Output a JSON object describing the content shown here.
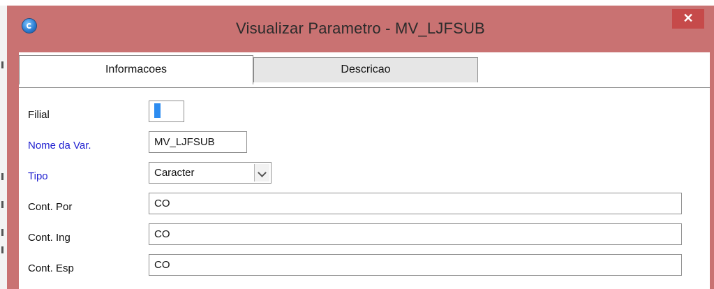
{
  "window": {
    "title": "Visualizar Parametro - MV_LJFSUB",
    "close_label": "✕"
  },
  "tabs": [
    {
      "label": "Informacoes",
      "active": true
    },
    {
      "label": "Descricao",
      "active": false
    }
  ],
  "form": {
    "filial": {
      "label": "Filial",
      "value": ""
    },
    "nome_var": {
      "label": "Nome da Var.",
      "value": "MV_LJFSUB"
    },
    "tipo": {
      "label": "Tipo",
      "value": "Caracter"
    },
    "cont_por": {
      "label": "Cont. Por",
      "value": "CO"
    },
    "cont_ing": {
      "label": "Cont. Ing",
      "value": "CO"
    },
    "cont_esp": {
      "label": "Cont. Esp",
      "value": "CO"
    }
  },
  "colors": {
    "titlebar": "#c97272",
    "close_button": "#c64a4a",
    "required_label": "#1f1fd0"
  }
}
